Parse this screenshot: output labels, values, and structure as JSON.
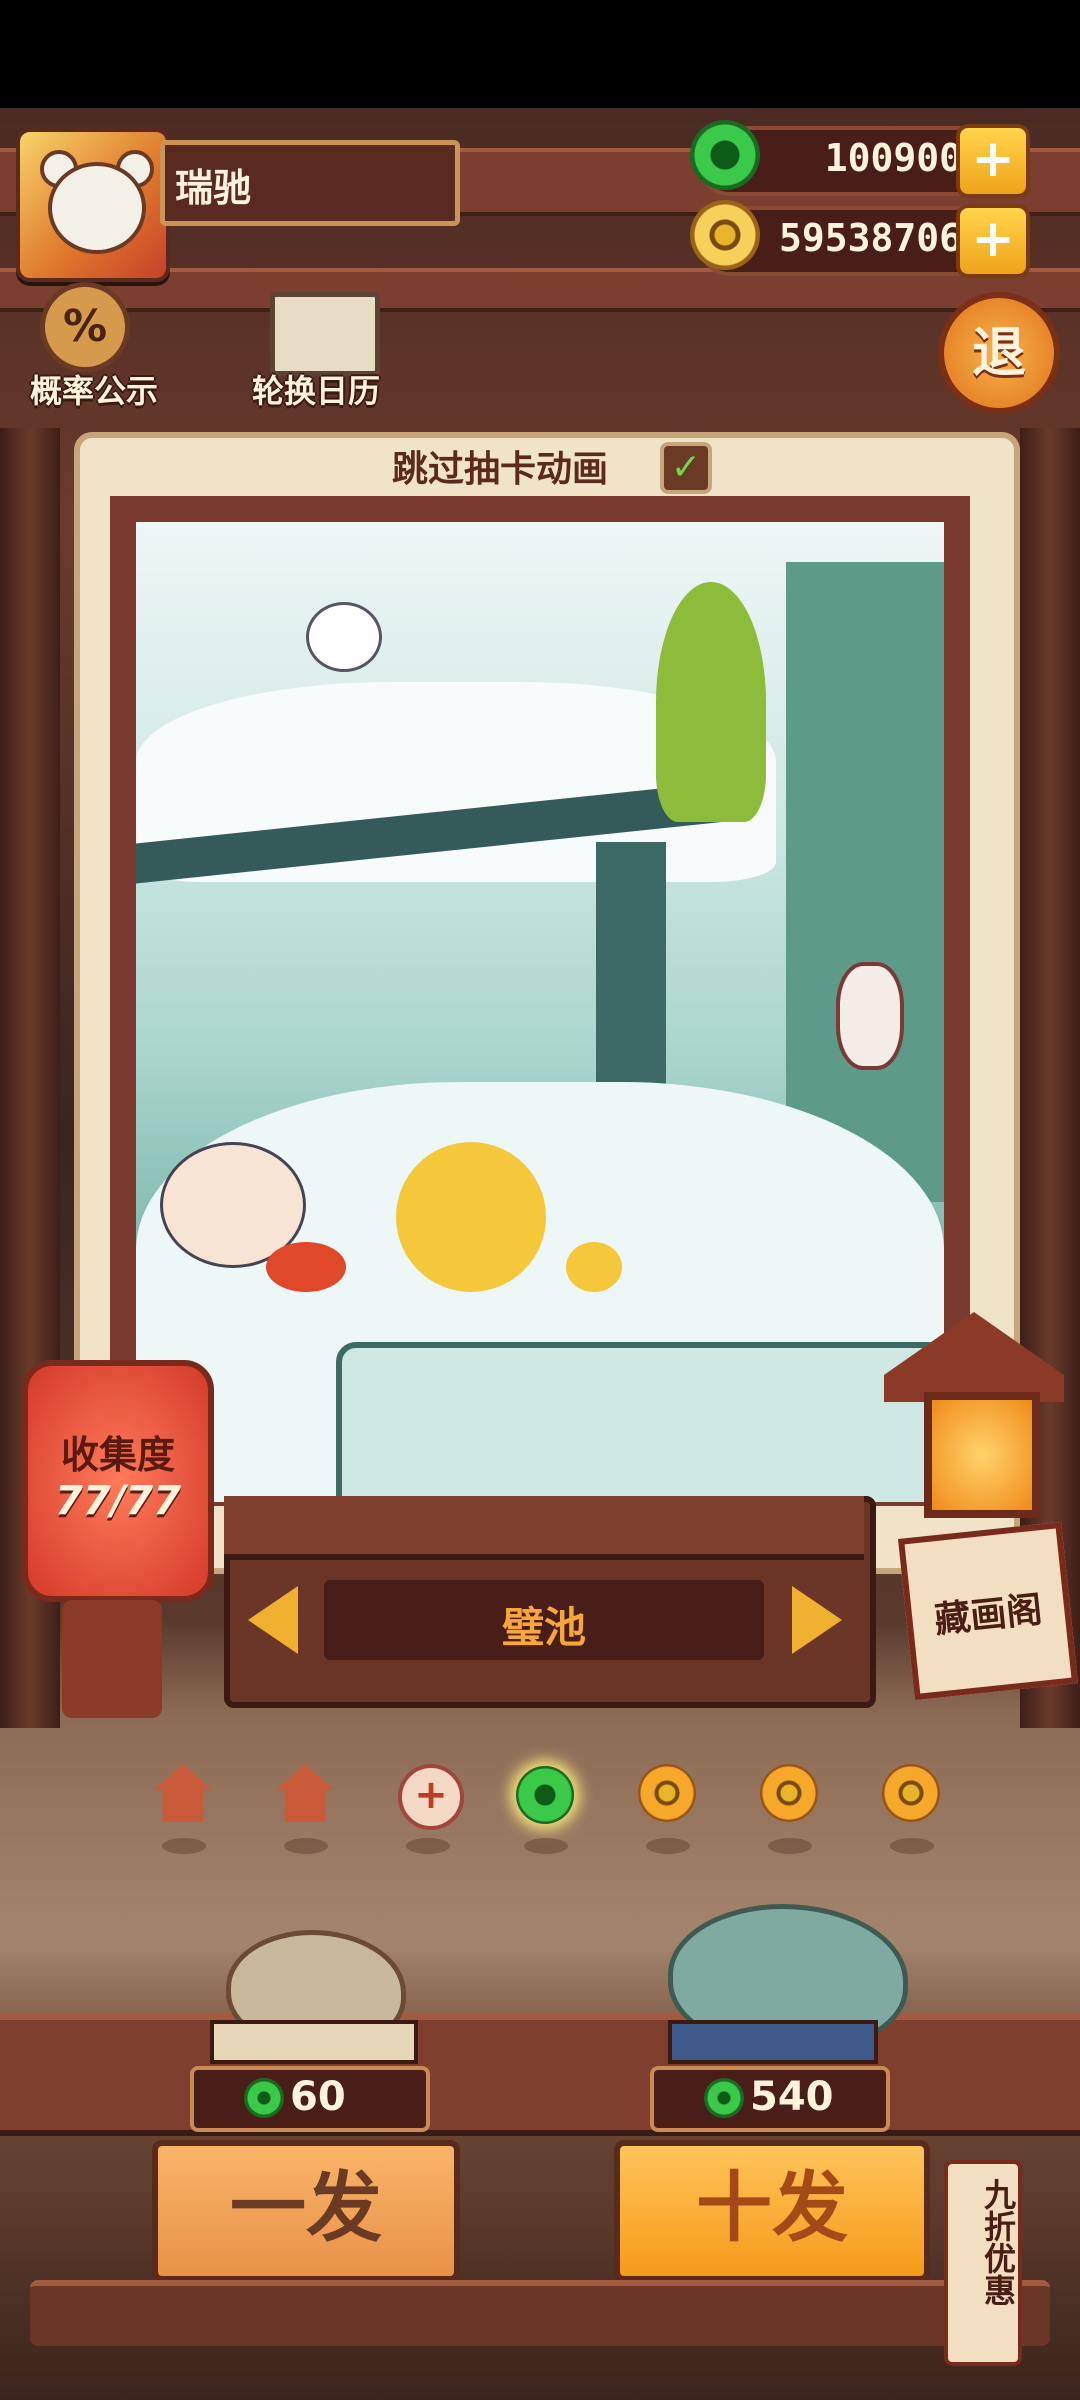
{
  "player": {
    "name": "瑞驰"
  },
  "currency": {
    "jade": "100900",
    "gold": "59538706"
  },
  "top_buttons": {
    "probability": "概率公示",
    "calendar": "轮换日历",
    "exit": "退"
  },
  "skip_animation": {
    "label": "跳过抽卡动画",
    "checked": true
  },
  "painting": {
    "name": "璧池"
  },
  "collection": {
    "label": "收集度",
    "progress": "77/77"
  },
  "gallery": {
    "label": "藏画阁"
  },
  "page_dots": [
    {
      "icon": "house-icon"
    },
    {
      "icon": "house-icon"
    },
    {
      "icon": "plus-icon",
      "glyph": "+"
    },
    {
      "icon": "jade-icon",
      "selected": true
    },
    {
      "icon": "coin-icon"
    },
    {
      "icon": "coin-icon"
    },
    {
      "icon": "coin-icon"
    }
  ],
  "draw": {
    "single": {
      "label": "一发",
      "cost": "60"
    },
    "ten": {
      "label": "十发",
      "cost": "540"
    }
  },
  "discount": {
    "label": "九折优惠"
  },
  "colors": {
    "accent_orange": "#f0b030",
    "jade_green": "#3bc94a",
    "wood": "#6b3527"
  }
}
